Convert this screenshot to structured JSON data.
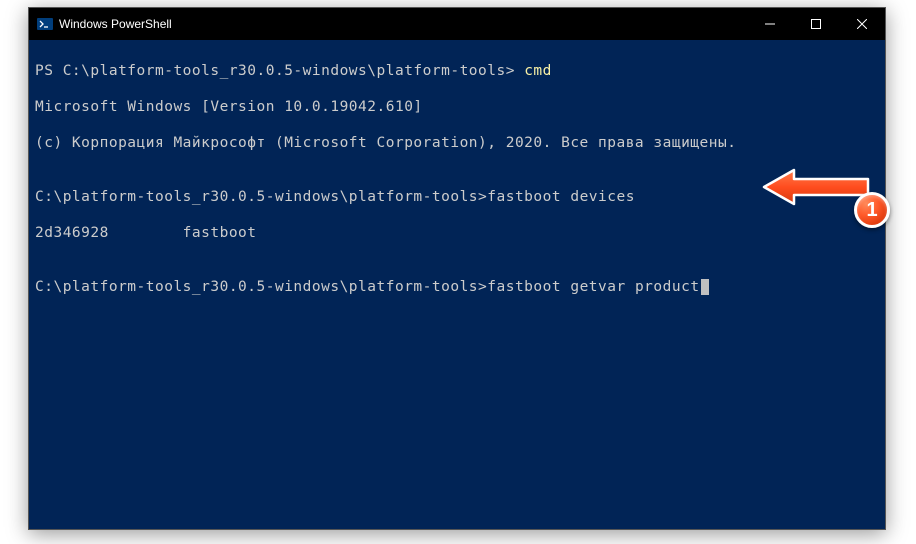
{
  "window": {
    "title": "Windows PowerShell"
  },
  "terminal": {
    "line1_prompt": "PS C:\\platform-tools_r30.0.5-windows\\platform-tools> ",
    "line1_cmd": "cmd",
    "line2": "Microsoft Windows [Version 10.0.19042.610]",
    "line3": "(c) Корпорация Майкрософт (Microsoft Corporation), 2020. Все права защищены.",
    "line4": "",
    "line5_prompt": "C:\\platform-tools_r30.0.5-windows\\platform-tools>",
    "line5_cmd": "fastboot devices",
    "line6": "2d346928        fastboot",
    "line7": "",
    "line8_prompt": "C:\\platform-tools_r30.0.5-windows\\platform-tools>",
    "line8_cmd": "fastboot getvar product"
  },
  "annotation": {
    "badge": "1"
  }
}
